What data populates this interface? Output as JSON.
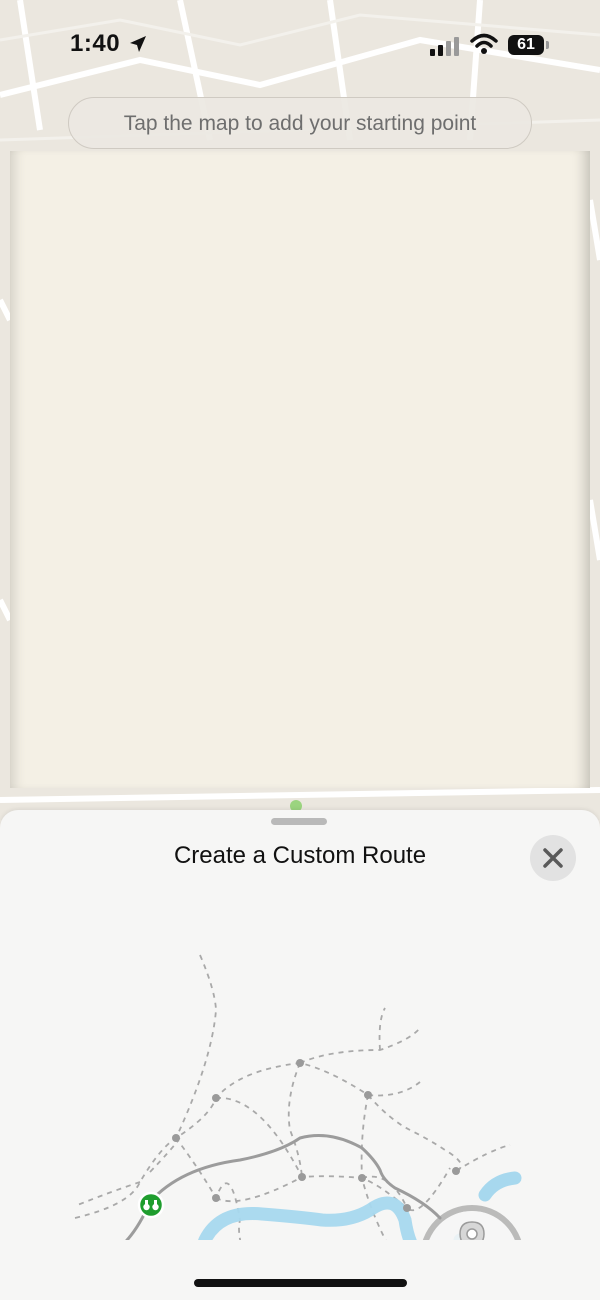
{
  "status_bar": {
    "time": "1:40",
    "battery": "61"
  },
  "hint": {
    "text": "Tap the map to add your starting point"
  },
  "sheet": {
    "title": "Create a Custom Route"
  },
  "icons": {
    "location": "location-arrow-icon",
    "signal": "cellular-signal-icon",
    "wifi": "wifi-icon",
    "close": "close-icon",
    "binoculars": "binoculars-icon",
    "pin": "map-pin-icon"
  },
  "colors": {
    "river": "#a7d8ee",
    "route_start": "#1f9d2e",
    "close_bg": "#e2e2e2"
  }
}
